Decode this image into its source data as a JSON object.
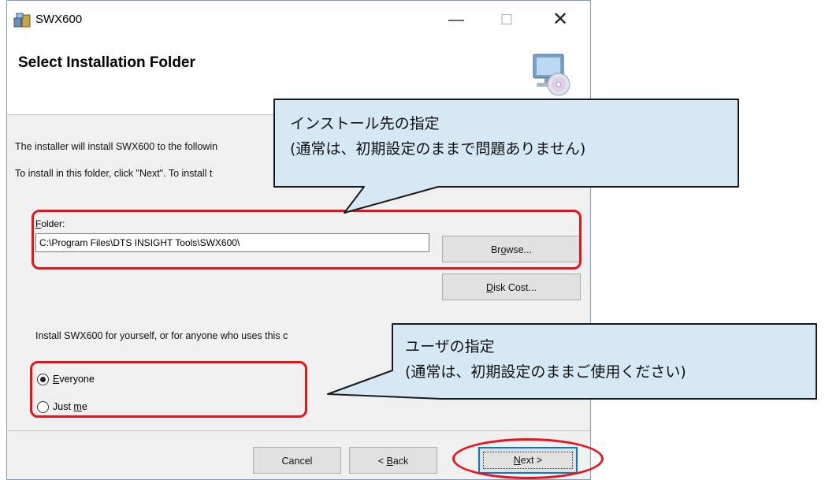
{
  "window": {
    "title": "SWX600",
    "minimize_glyph": "—",
    "maximize_glyph": "☐",
    "close_glyph": "✕"
  },
  "header": {
    "title": "Select Installation Folder"
  },
  "body": {
    "line1": "The installer will install SWX600 to the followin",
    "line2": "To install in this folder, click \"Next\". To install t",
    "folder_label_accel": "F",
    "folder_label_rest": "older:",
    "folder_value": "C:\\Program Files\\DTS INSIGHT Tools\\SWX600\\",
    "browse_pre": "Br",
    "browse_accel": "o",
    "browse_post": "wse...",
    "diskcost_accel": "D",
    "diskcost_rest": "isk Cost...",
    "install_for": "Install SWX600 for yourself, or for anyone who uses this c",
    "everyone_accel": "E",
    "everyone_rest": "veryone",
    "justme_pre": "Just ",
    "justme_accel": "m",
    "justme_post": "e"
  },
  "footer": {
    "cancel": "Cancel",
    "back_prefix": "< ",
    "back_accel": "B",
    "back_rest": "ack",
    "next_accel": "N",
    "next_rest": "ext >"
  },
  "callouts": {
    "folder_line1": "インストール先の指定",
    "folder_line2": "(通常は、初期設定のままで問題ありません)",
    "user_line1": "ユーザの指定",
    "user_line2": "(通常は、初期設定のままご使用ください)"
  },
  "colors": {
    "callout_fill": "#d6e8f3",
    "highlight": "#e8141c",
    "focus": "#0078d7"
  },
  "radio_selected": "everyone"
}
